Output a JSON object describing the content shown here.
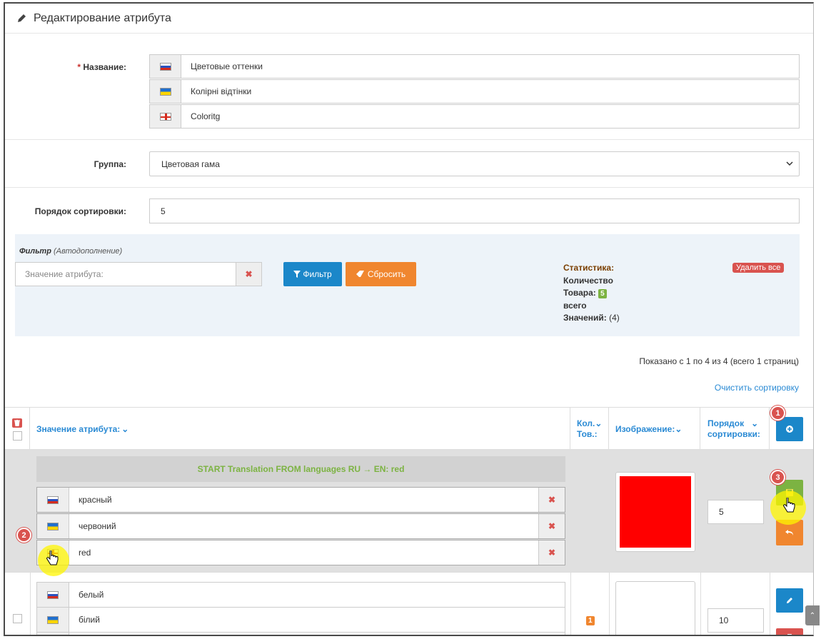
{
  "header": {
    "title": "Редактирование атрибута",
    "icon": "pencil-icon"
  },
  "name_field": {
    "label": "Название:",
    "required_mark": "*",
    "values": [
      {
        "lang": "ru",
        "value": "Цветовые оттенки"
      },
      {
        "lang": "ua",
        "value": "Колірні відтінки"
      },
      {
        "lang": "en",
        "value": "Coloritg"
      }
    ]
  },
  "group_field": {
    "label": "Группа:",
    "value": "Цветовая гама"
  },
  "sort_field": {
    "label": "Порядок сортировки:",
    "value": "5"
  },
  "filter": {
    "title": "Фильтр",
    "subtitle": "(Автодополнение)",
    "placeholder": "Значение атрибута:",
    "filter_button": "Фильтр",
    "reset_button": "Сбросить",
    "stats_title": "Статистика:",
    "stats_qty_label_1": "Количество",
    "stats_qty_label_2": "Товара:",
    "stats_qty_value": "5",
    "stats_total_label": "всего",
    "stats_values_label": "Значений:",
    "stats_values_count": "(4)",
    "delete_all": "Удалить все"
  },
  "pager": {
    "text": "Показано с 1 по 4 из 4 (всего 1 страниц)",
    "clear_sort": "Очистить сортировку"
  },
  "table": {
    "headers": {
      "value": "Значение атрибута:",
      "qty_1": "Кол.",
      "qty_2": "Тов.:",
      "image": "Изображение:",
      "sort_1": "Порядок",
      "sort_2": "сортировки:"
    },
    "rows": [
      {
        "translation_note": "START Translation FROM languages RU → EN: red",
        "values": [
          {
            "lang": "ru",
            "value": "красный"
          },
          {
            "lang": "ua",
            "value": "червоний"
          },
          {
            "lang": "en",
            "value": "red"
          }
        ],
        "image_color": "#ff0000",
        "sort": "5"
      },
      {
        "values": [
          {
            "lang": "ru",
            "value": "белый"
          },
          {
            "lang": "ua",
            "value": "білий"
          }
        ],
        "qty": "1",
        "sort": "10"
      }
    ]
  },
  "markers": {
    "m1": "1",
    "m2": "2",
    "m3": "3"
  },
  "colors": {
    "accent_blue": "#1b87c9",
    "orange": "#f0862f",
    "green": "#7cb342",
    "red": "#d9534f"
  }
}
